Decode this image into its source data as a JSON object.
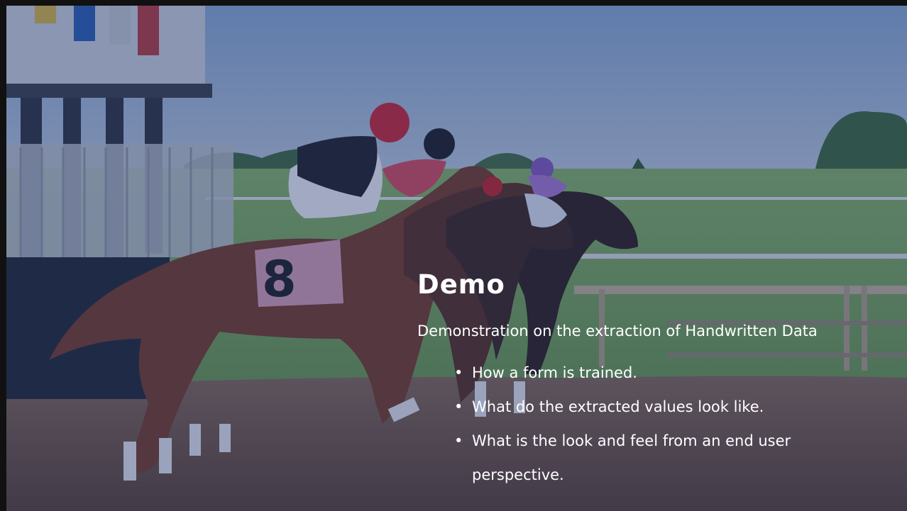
{
  "slide": {
    "title": "Demo",
    "subtitle": "Demonstration on the extraction of Handwritten Data",
    "bullets": [
      "How a form is trained.",
      "What do the extracted values look like.",
      "What is the look and feel from an end user perspective."
    ],
    "bullet_symbol": "•",
    "background_image": "horse-race-starting-gate-photo"
  },
  "colors": {
    "overlay": "#1e346e",
    "text": "#ffffff",
    "sky": "#9fb6d3",
    "grass": "#7fae55",
    "dirt": "#6b4a33"
  }
}
